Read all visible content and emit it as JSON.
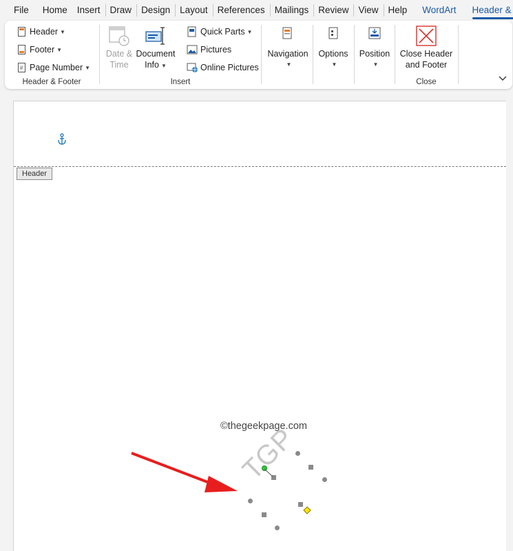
{
  "tabs": [
    {
      "label": "File"
    },
    {
      "label": "Home"
    },
    {
      "label": "Insert"
    },
    {
      "label": "Draw"
    },
    {
      "label": "Design"
    },
    {
      "label": "Layout"
    },
    {
      "label": "References"
    },
    {
      "label": "Mailings"
    },
    {
      "label": "Review"
    },
    {
      "label": "View"
    },
    {
      "label": "Help"
    },
    {
      "label": "WordArt"
    },
    {
      "label": "Header & Foc"
    }
  ],
  "ribbon": {
    "header_footer_group": {
      "label": "Header & Footer",
      "header": "Header",
      "footer": "Footer",
      "page_number": "Page Number"
    },
    "insert_group": {
      "label": "Insert",
      "date_time_line1": "Date &",
      "date_time_line2": "Time",
      "doc_info_line1": "Document",
      "doc_info_line2": "Info",
      "quick_parts": "Quick Parts",
      "pictures": "Pictures",
      "online_pictures": "Online Pictures"
    },
    "navigation": "Navigation",
    "options": "Options",
    "position": "Position",
    "close_group": {
      "label": "Close",
      "close_line1": "Close Header",
      "close_line2": "and Footer"
    }
  },
  "document": {
    "header_tag": "Header",
    "watermark_source": "©thegeekpage.com",
    "wordart_text": "TGP"
  },
  "colors": {
    "accent": "#1a5aa8",
    "close_red": "#d9342b",
    "arrow_red": "#e81e1e"
  }
}
